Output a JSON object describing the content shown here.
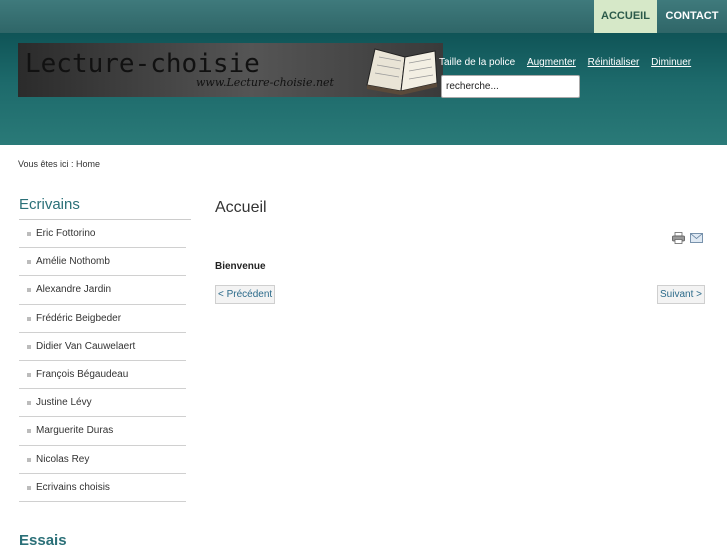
{
  "nav": {
    "items": [
      {
        "label": "ACCUEIL"
      },
      {
        "label": "CONTACT"
      }
    ]
  },
  "header": {
    "banner_title": "Lecture-choisie",
    "banner_url": "www.Lecture-choisie.net",
    "font_size": {
      "label": "Taille de la police",
      "increase": "Augmenter",
      "reset": "Réinitialiser",
      "decrease": "Diminuer"
    },
    "search": {
      "value": "recherche..."
    }
  },
  "breadcrumb": {
    "text": "Vous êtes ici : Home"
  },
  "sidebar": {
    "heading": "Ecrivains",
    "items": [
      {
        "label": "Eric Fottorino"
      },
      {
        "label": "Amélie Nothomb"
      },
      {
        "label": "Alexandre Jardin"
      },
      {
        "label": "Frédéric Beigbeder"
      },
      {
        "label": "Didier Van Cauwelaert"
      },
      {
        "label": "François Bégaudeau"
      },
      {
        "label": "Justine Lévy"
      },
      {
        "label": "Marguerite Duras"
      },
      {
        "label": "Nicolas Rey"
      },
      {
        "label": "Ecrivains choisis"
      }
    ],
    "next_heading": "Essais"
  },
  "main": {
    "title": "Accueil",
    "welcome": "Bienvenue",
    "prev_label": "< Précédent",
    "next_label": "Suivant >"
  },
  "icons": {
    "print": "printer-icon",
    "email": "email-icon"
  }
}
